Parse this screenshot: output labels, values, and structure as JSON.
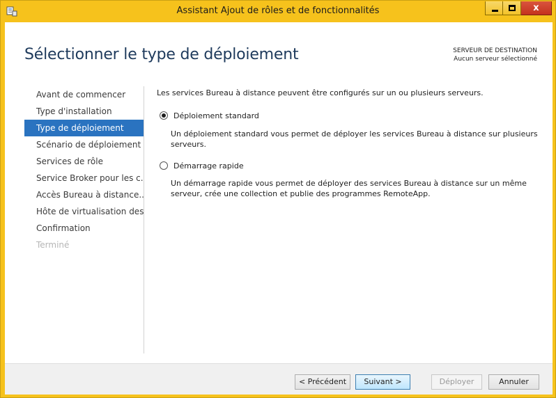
{
  "window": {
    "title": "Assistant Ajout de rôles et de fonctionnalités",
    "controls": {
      "minimize_icon": "minimize-icon",
      "maximize_icon": "maximize-icon",
      "close_label": "x"
    },
    "frame_color": "#f6c21c"
  },
  "header": {
    "page_title": "Sélectionner le type de déploiement",
    "destination_label": "SERVEUR DE DESTINATION",
    "destination_value": "Aucun serveur sélectionné"
  },
  "nav": {
    "items": [
      {
        "label": "Avant de commencer",
        "state": "normal"
      },
      {
        "label": "Type d'installation",
        "state": "normal"
      },
      {
        "label": "Type de déploiement",
        "state": "selected"
      },
      {
        "label": "Scénario de déploiement",
        "state": "normal"
      },
      {
        "label": "Services de rôle",
        "state": "normal"
      },
      {
        "label": "Service Broker pour les c...",
        "state": "normal"
      },
      {
        "label": "Accès Bureau à distance...",
        "state": "normal"
      },
      {
        "label": "Hôte de virtualisation des...",
        "state": "normal"
      },
      {
        "label": "Confirmation",
        "state": "normal"
      },
      {
        "label": "Terminé",
        "state": "disabled"
      }
    ],
    "selected_color": "#2a73c0"
  },
  "content": {
    "intro": "Les services Bureau à distance peuvent être configurés sur un ou plusieurs serveurs.",
    "options": [
      {
        "label": "Déploiement standard",
        "checked": true,
        "description": "Un déploiement standard vous permet de déployer les services Bureau à distance sur plusieurs serveurs."
      },
      {
        "label": "Démarrage rapide",
        "checked": false,
        "description": "Un démarrage rapide vous permet de déployer des services Bureau à distance sur un même serveur, crée une collection et publie des programmes RemoteApp."
      }
    ]
  },
  "footer": {
    "previous_label": "< Précédent",
    "next_label": "Suivant >",
    "deploy_label": "Déployer",
    "cancel_label": "Annuler"
  }
}
